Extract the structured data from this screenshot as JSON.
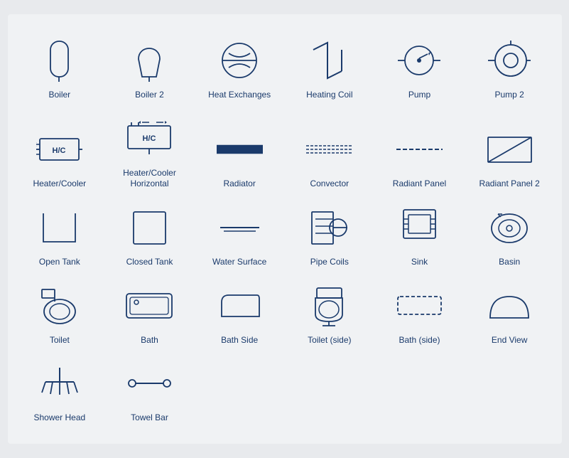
{
  "items": [
    {
      "name": "Boiler",
      "id": "boiler"
    },
    {
      "name": "Boiler 2",
      "id": "boiler2"
    },
    {
      "name": "Heat Exchanges",
      "id": "heat-exchanges"
    },
    {
      "name": "Heating Coil",
      "id": "heating-coil"
    },
    {
      "name": "Pump",
      "id": "pump"
    },
    {
      "name": "Pump 2",
      "id": "pump2"
    },
    {
      "name": "Heater/Cooler",
      "id": "heater-cooler"
    },
    {
      "name": "Heater/Cooler Horizontal",
      "id": "heater-cooler-h"
    },
    {
      "name": "Radiator",
      "id": "radiator"
    },
    {
      "name": "Convector",
      "id": "convector"
    },
    {
      "name": "Radiant Panel",
      "id": "radiant-panel"
    },
    {
      "name": "Radiant Panel 2",
      "id": "radiant-panel2"
    },
    {
      "name": "Open Tank",
      "id": "open-tank"
    },
    {
      "name": "Closed Tank",
      "id": "closed-tank"
    },
    {
      "name": "Water Surface",
      "id": "water-surface"
    },
    {
      "name": "Pipe Coils",
      "id": "pipe-coils"
    },
    {
      "name": "Sink",
      "id": "sink"
    },
    {
      "name": "Basin",
      "id": "basin"
    },
    {
      "name": "Toilet",
      "id": "toilet"
    },
    {
      "name": "Bath",
      "id": "bath"
    },
    {
      "name": "Bath Side",
      "id": "bath-side"
    },
    {
      "name": "Toilet (side)",
      "id": "toilet-side"
    },
    {
      "name": "Bath (side)",
      "id": "bath-side2"
    },
    {
      "name": "End View",
      "id": "end-view"
    },
    {
      "name": "Shower Head",
      "id": "shower-head"
    },
    {
      "name": "Towel Bar",
      "id": "towel-bar"
    }
  ]
}
